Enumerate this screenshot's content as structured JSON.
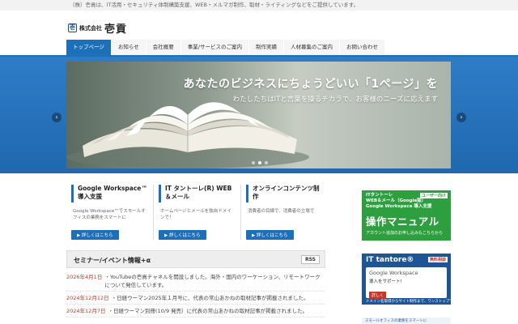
{
  "tagline": "（株）壱貢は、IT活用・セキュリティ体制構築支援、WEB・メルマガ制作、取材・ライティングなどをご提供しています。",
  "logo": {
    "mark": "壱",
    "small": "株式会社",
    "big": "壱貢"
  },
  "nav": [
    {
      "label": "トップページ"
    },
    {
      "label": "お知らせ"
    },
    {
      "label": "会社概要"
    },
    {
      "label": "事業/サービスのご案内"
    },
    {
      "label": "制作実績"
    },
    {
      "label": "人材募集のご案内"
    },
    {
      "label": "お問い合わせ"
    }
  ],
  "hero": {
    "headline": "あなたのビジネスにちょうどいい「1ページ」を",
    "subline": "わたしたちはITと言葉を操るチカラで、お客様のニーズに応えます",
    "prev": "‹",
    "next": "›"
  },
  "cards": [
    {
      "title": "Google Workspace™ 導入支援",
      "desc": "Google Workspace™でスモールオフィスの業務をスマートに",
      "button": "詳しくはこちら"
    },
    {
      "title": "IT タントーレ(R) WEB＆メール",
      "desc": "ホームページとメールを独自ドメインで！",
      "button": "詳しくはこちら"
    },
    {
      "title": "オンラインコンテンツ制作",
      "desc": "消費者の目線で、消費者の立場で",
      "button": "詳しくはこちら"
    }
  ],
  "seminar": {
    "title": "セミナー/イベント情報+α",
    "rss": "RSS"
  },
  "news": [
    {
      "date": "2026年4月1日",
      "text": "YouTubeの壱貢チャネルを開設しました。海外・国内のワーケーション、リモートワークについて発信しています。"
    },
    {
      "date": "2024年12月12日",
      "text": "日経ウーマン2025年１月号に、代表の常山あかねの取材記事が掲載されました。"
    },
    {
      "date": "2024年12月7日",
      "text": "日経ウーマン別冊(10/9 発売）に代表の常山あかねの取材記事が掲載されました。"
    }
  ],
  "banner1": {
    "line1": "ITタントーレ",
    "line2": "WEB＆メール（Google版）",
    "line3": "Google Workspace 導入支援",
    "tag": "ユーザー向け",
    "big": "操作マニュアル",
    "small": "アカウント追加のお申し込みもこちらから"
  },
  "banner2": {
    "title": "IT tantore®",
    "tag": "無料相談",
    "g": "Google Workspace",
    "gs": "導入をサポート!",
    "btn": "詳しく",
    "foot": "ドメイン名取得からサイト制作まで、ワンストップで構築"
  },
  "banner3": {
    "text": "スモールオフィスの業務をスマートに"
  },
  "colors": {
    "brand": "#1d70b7",
    "green": "#2e9f3f",
    "navy": "#1e5596",
    "date": "#c0392b"
  }
}
